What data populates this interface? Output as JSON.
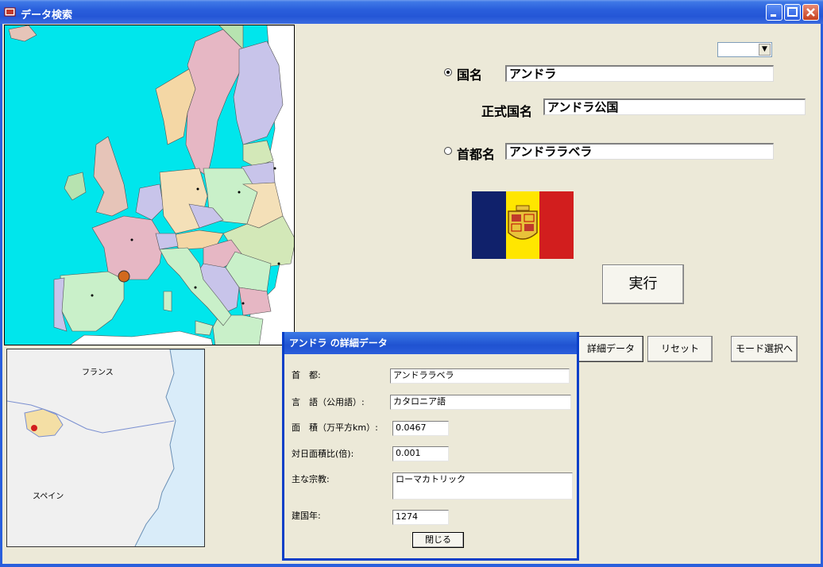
{
  "window": {
    "title": "データ検索"
  },
  "search": {
    "country_label": "国名",
    "country_value": "アンドラ",
    "official_label": "正式国名",
    "official_value": "アンドラ公国",
    "capital_label": "首都名",
    "capital_value": "アンドララベラ",
    "combo_value": "",
    "selected_mode": "country"
  },
  "buttons": {
    "execute": "実行",
    "detail": "詳細データ",
    "reset": "リセット",
    "mode_select": "モード選択へ"
  },
  "map": {
    "label_france": "フランス",
    "label_spain": "スペイン"
  },
  "flag": {
    "colors": [
      "#10216b",
      "#ffe600",
      "#d21e1e"
    ]
  },
  "dialog": {
    "title": "アンドラ の詳細データ",
    "capital_label": "首　都:",
    "capital_value": "アンドララベラ",
    "language_label": "言　語（公用語）:",
    "language_value": "カタロニア語",
    "area_label": "面　積（万平方km）:",
    "area_value": "0.0467",
    "ratio_label": "対日面積比(倍):",
    "ratio_value": "0.001",
    "religion_label": "主な宗教:",
    "religion_value": "ローマカトリック",
    "founded_label": "建国年:",
    "founded_value": "1274",
    "close_button": "閉じる"
  },
  "colors": {
    "titlebar": "#2456d6",
    "sea": "#00e6ec",
    "window_bg": "#ece9d8"
  }
}
